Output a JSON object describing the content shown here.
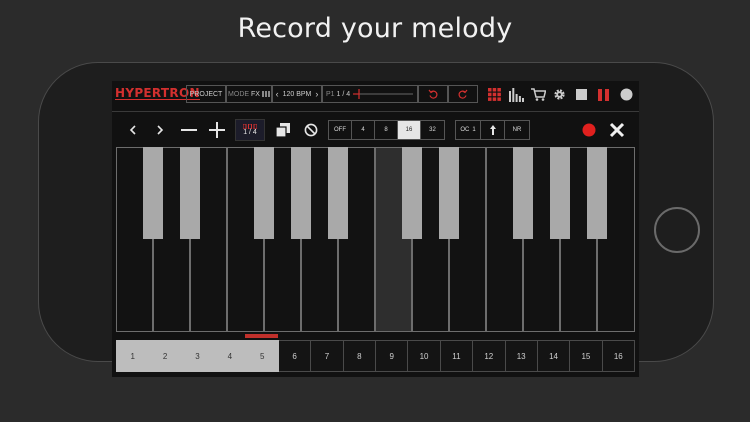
{
  "headline": "Record your melody",
  "app": {
    "logo": "HYPERTRON",
    "project_label": "PROJECT",
    "mode_label": "MODE",
    "mode_value": "FX",
    "bpm": "120 BPM",
    "pattern": "P1",
    "pattern_pos": "1 / 4"
  },
  "toolbar": {
    "page_counter": "1 / 4",
    "quantize": [
      {
        "label": "OFF",
        "selected": false
      },
      {
        "label": "4",
        "selected": false
      },
      {
        "label": "8",
        "selected": false
      },
      {
        "label": "16",
        "selected": true
      },
      {
        "label": "32",
        "selected": false
      }
    ],
    "octave_label": "OC",
    "octave_value": "1",
    "note_repeat": "NR"
  },
  "keyboard": {
    "white_keys": 14,
    "active_white_key": 7
  },
  "steps": {
    "labels": [
      "1",
      "2",
      "3",
      "4",
      "5",
      "6",
      "7",
      "8",
      "9",
      "10",
      "11",
      "12",
      "13",
      "14",
      "15",
      "16"
    ],
    "active_count": 5,
    "current_step": 5
  },
  "colors": {
    "accent": "#d3302f",
    "background": "#2b2b2b"
  }
}
